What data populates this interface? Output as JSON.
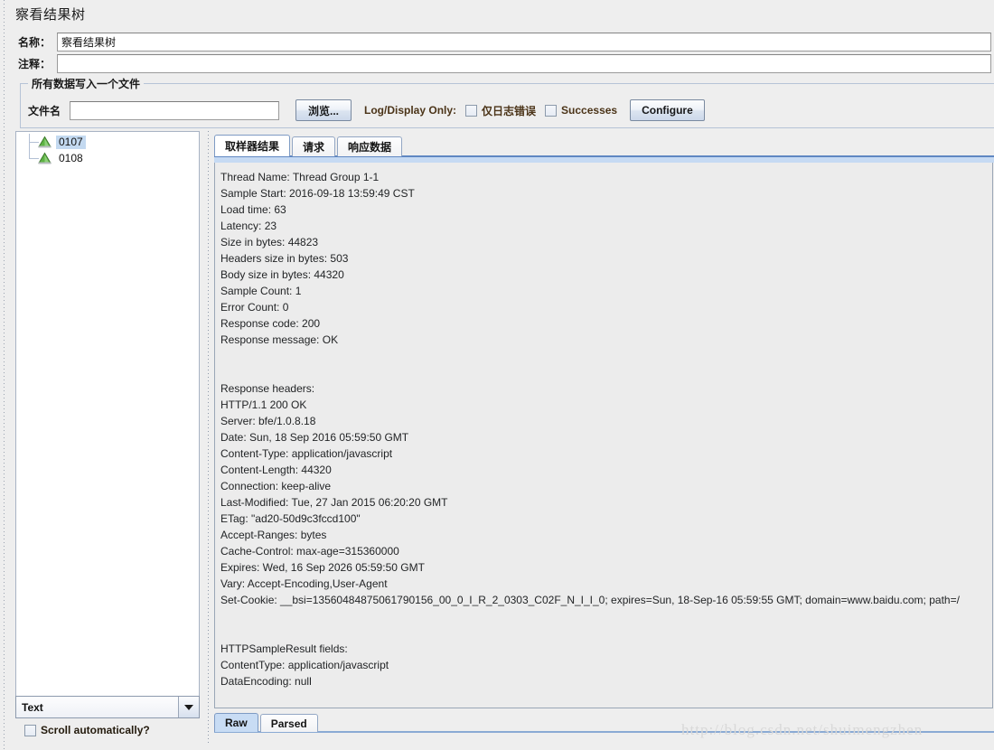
{
  "window": {
    "title": "察看结果树"
  },
  "fields": {
    "name_label": "名称：",
    "name_value": "察看结果树",
    "comment_label": "注释：",
    "comment_value": ""
  },
  "filegroup": {
    "legend": "所有数据写入一个文件",
    "filename_label": "文件名",
    "filename_value": "",
    "browse_button": "浏览...",
    "log_display_label": "Log/Display Only:",
    "errors_checkbox": "仅日志错误",
    "successes_checkbox": "Successes",
    "configure_button": "Configure"
  },
  "tree": {
    "items": [
      {
        "label": "0107",
        "selected": true,
        "icon": "green-triangle-icon"
      },
      {
        "label": "0108",
        "selected": false,
        "icon": "green-triangle-icon"
      }
    ]
  },
  "render_select": {
    "value": "Text",
    "arrow_icon": "chevron-down-icon"
  },
  "scroll_option": {
    "label": "Scroll automatically?",
    "checked": false
  },
  "tabs": [
    {
      "label": "取样器结果",
      "active": true
    },
    {
      "label": "请求",
      "active": false
    },
    {
      "label": "响应数据",
      "active": false
    }
  ],
  "bottom_tabs": [
    {
      "label": "Raw",
      "active": true
    },
    {
      "label": "Parsed",
      "active": false
    }
  ],
  "sampler_result": {
    "lines": [
      "Thread Name: Thread Group 1-1",
      "Sample Start: 2016-09-18 13:59:49 CST",
      "Load time: 63",
      "Latency: 23",
      "Size in bytes: 44823",
      "Headers size in bytes: 503",
      "Body size in bytes: 44320",
      "Sample Count: 1",
      "Error Count: 0",
      "Response code: 200",
      "Response message: OK",
      "",
      "",
      "Response headers:",
      "HTTP/1.1 200 OK",
      "Server: bfe/1.0.8.18",
      "Date: Sun, 18 Sep 2016 05:59:50 GMT",
      "Content-Type: application/javascript",
      "Content-Length: 44320",
      "Connection: keep-alive",
      "Last-Modified: Tue, 27 Jan 2015 06:20:20 GMT",
      "ETag: \"ad20-50d9c3fccd100\"",
      "Accept-Ranges: bytes",
      "Cache-Control: max-age=315360000",
      "Expires: Wed, 16 Sep 2026 05:59:50 GMT",
      "Vary: Accept-Encoding,User-Agent",
      "Set-Cookie: __bsi=13560484875061790156_00_0_I_R_2_0303_C02F_N_I_I_0; expires=Sun, 18-Sep-16 05:59:55 GMT; domain=www.baidu.com; path=/",
      "",
      "",
      "HTTPSampleResult fields:",
      "ContentType: application/javascript",
      "DataEncoding: null"
    ]
  },
  "watermark": {
    "text": "http://blog.csdn.net/shuimengzhen"
  },
  "colors": {
    "accent": "#5f87c2",
    "selection": "#c3d9f0",
    "panel_bg": "#eeeeee",
    "content_bg": "#ececec",
    "success_icon": "#4c9c3a"
  }
}
